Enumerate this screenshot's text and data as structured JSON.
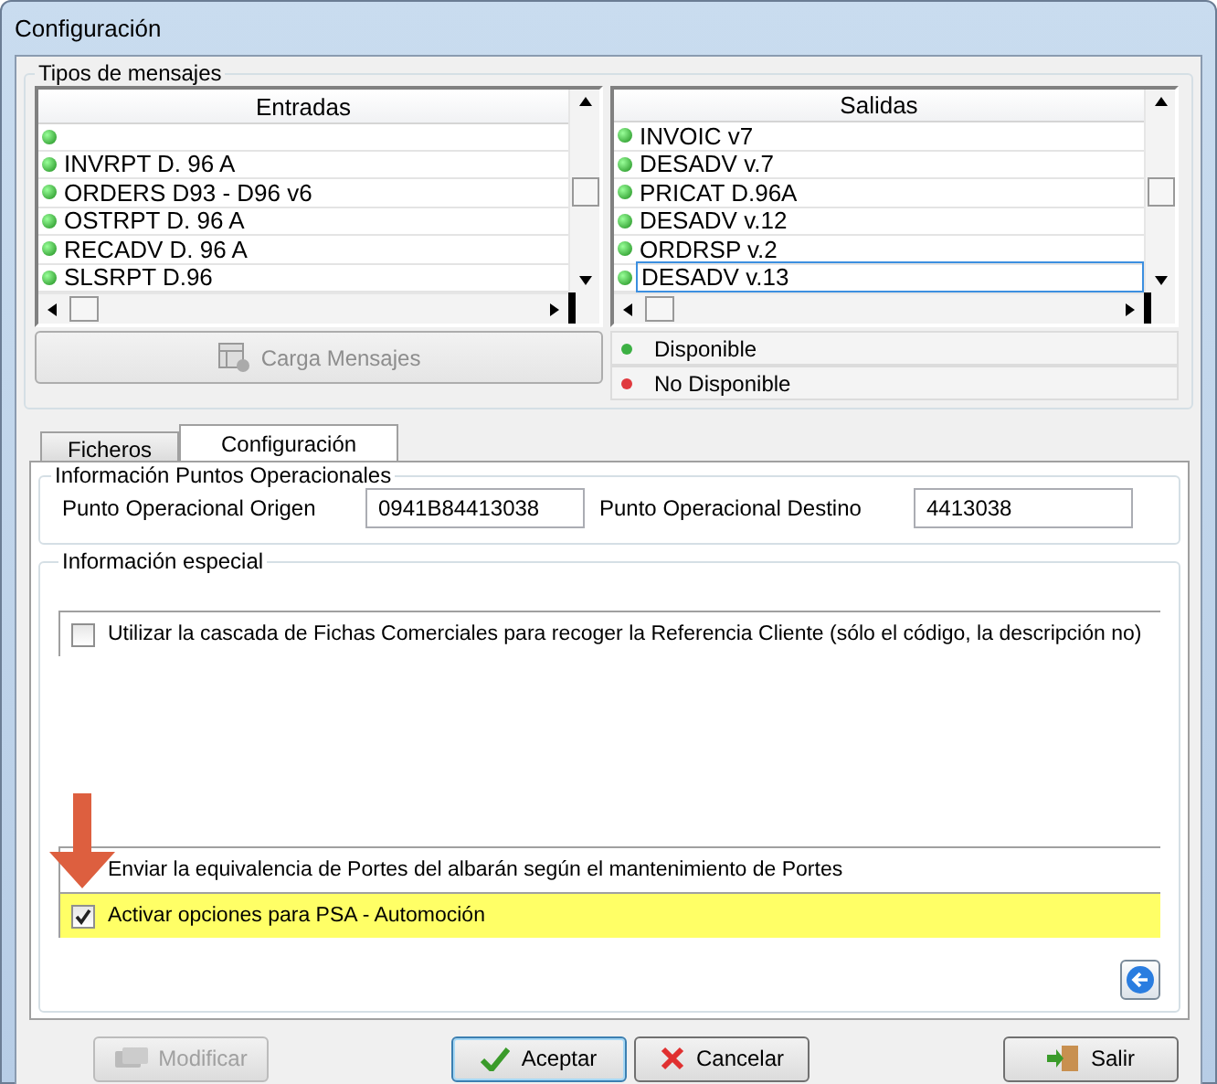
{
  "window": {
    "title": "Configuración"
  },
  "message_types": {
    "title": "Tipos de mensajes",
    "incoming": {
      "header": "Entradas",
      "items": [
        {
          "available": true
        },
        {
          "label": "INVRPT D. 96 A",
          "available": true,
          "selected": false
        },
        {
          "label": "ORDERS D93 - D96 v6",
          "available": true,
          "selected": false
        },
        {
          "label": "OSTRPT D. 96 A",
          "available": true,
          "selected": false
        },
        {
          "label": "RECADV D. 96 A",
          "available": true,
          "selected": false
        },
        {
          "label": "SLSRPT D.96",
          "available": true,
          "selected": false
        }
      ]
    },
    "outgoing": {
      "header": "Salidas",
      "items": [
        {
          "label": "INVOIC v7",
          "available": true,
          "selected": false
        },
        {
          "label": "DESADV v.7",
          "available": true,
          "selected": false
        },
        {
          "label": "PRICAT D.96A",
          "available": true,
          "selected": false
        },
        {
          "label": "DESADV v.12",
          "available": true,
          "selected": false
        },
        {
          "label": "ORDRSP v.2",
          "available": true,
          "selected": false
        },
        {
          "label": "DESADV v.13",
          "available": true,
          "selected": true
        }
      ]
    },
    "load_button": {
      "label": "Carga Mensajes",
      "disabled": true
    },
    "legend": [
      {
        "label": "Disponible",
        "color": "#3cb043"
      },
      {
        "label": "No Disponible",
        "color": "#e0393e"
      }
    ]
  },
  "tabs": [
    {
      "label": "Ficheros",
      "selected": false
    },
    {
      "label": "Configuración",
      "selected": true
    }
  ],
  "operational_points": {
    "title": "Información Puntos Operacionales",
    "fields": [
      {
        "label": "Punto Operacional Origen",
        "value": "0941B84413038"
      },
      {
        "label": "Punto Operacional Destino",
        "value": "4413038"
      }
    ]
  },
  "special_info": {
    "title": "Información especial",
    "options": [
      {
        "label": "Utilizar la cascada de Fichas Comerciales para recoger la Referencia Cliente (sólo el código, la descripción no)",
        "checked": false,
        "highlighted": false
      },
      {
        "label": "Enviar la equivalencia de Portes del albarán según el mantenimiento de Portes",
        "covered": true,
        "highlighted": false
      },
      {
        "label": "Activar opciones para PSA - Automoción",
        "checked": true,
        "highlighted": true
      }
    ]
  },
  "buttons": [
    {
      "kind": "modify",
      "label": "Modificar",
      "disabled": true,
      "default": false
    },
    {
      "kind": "accept",
      "label": "Aceptar",
      "disabled": false,
      "default": true
    },
    {
      "kind": "cancel",
      "label": "Cancelar",
      "disabled": false,
      "default": false
    },
    {
      "kind": "exit",
      "label": "Salir",
      "disabled": false,
      "default": false
    }
  ]
}
